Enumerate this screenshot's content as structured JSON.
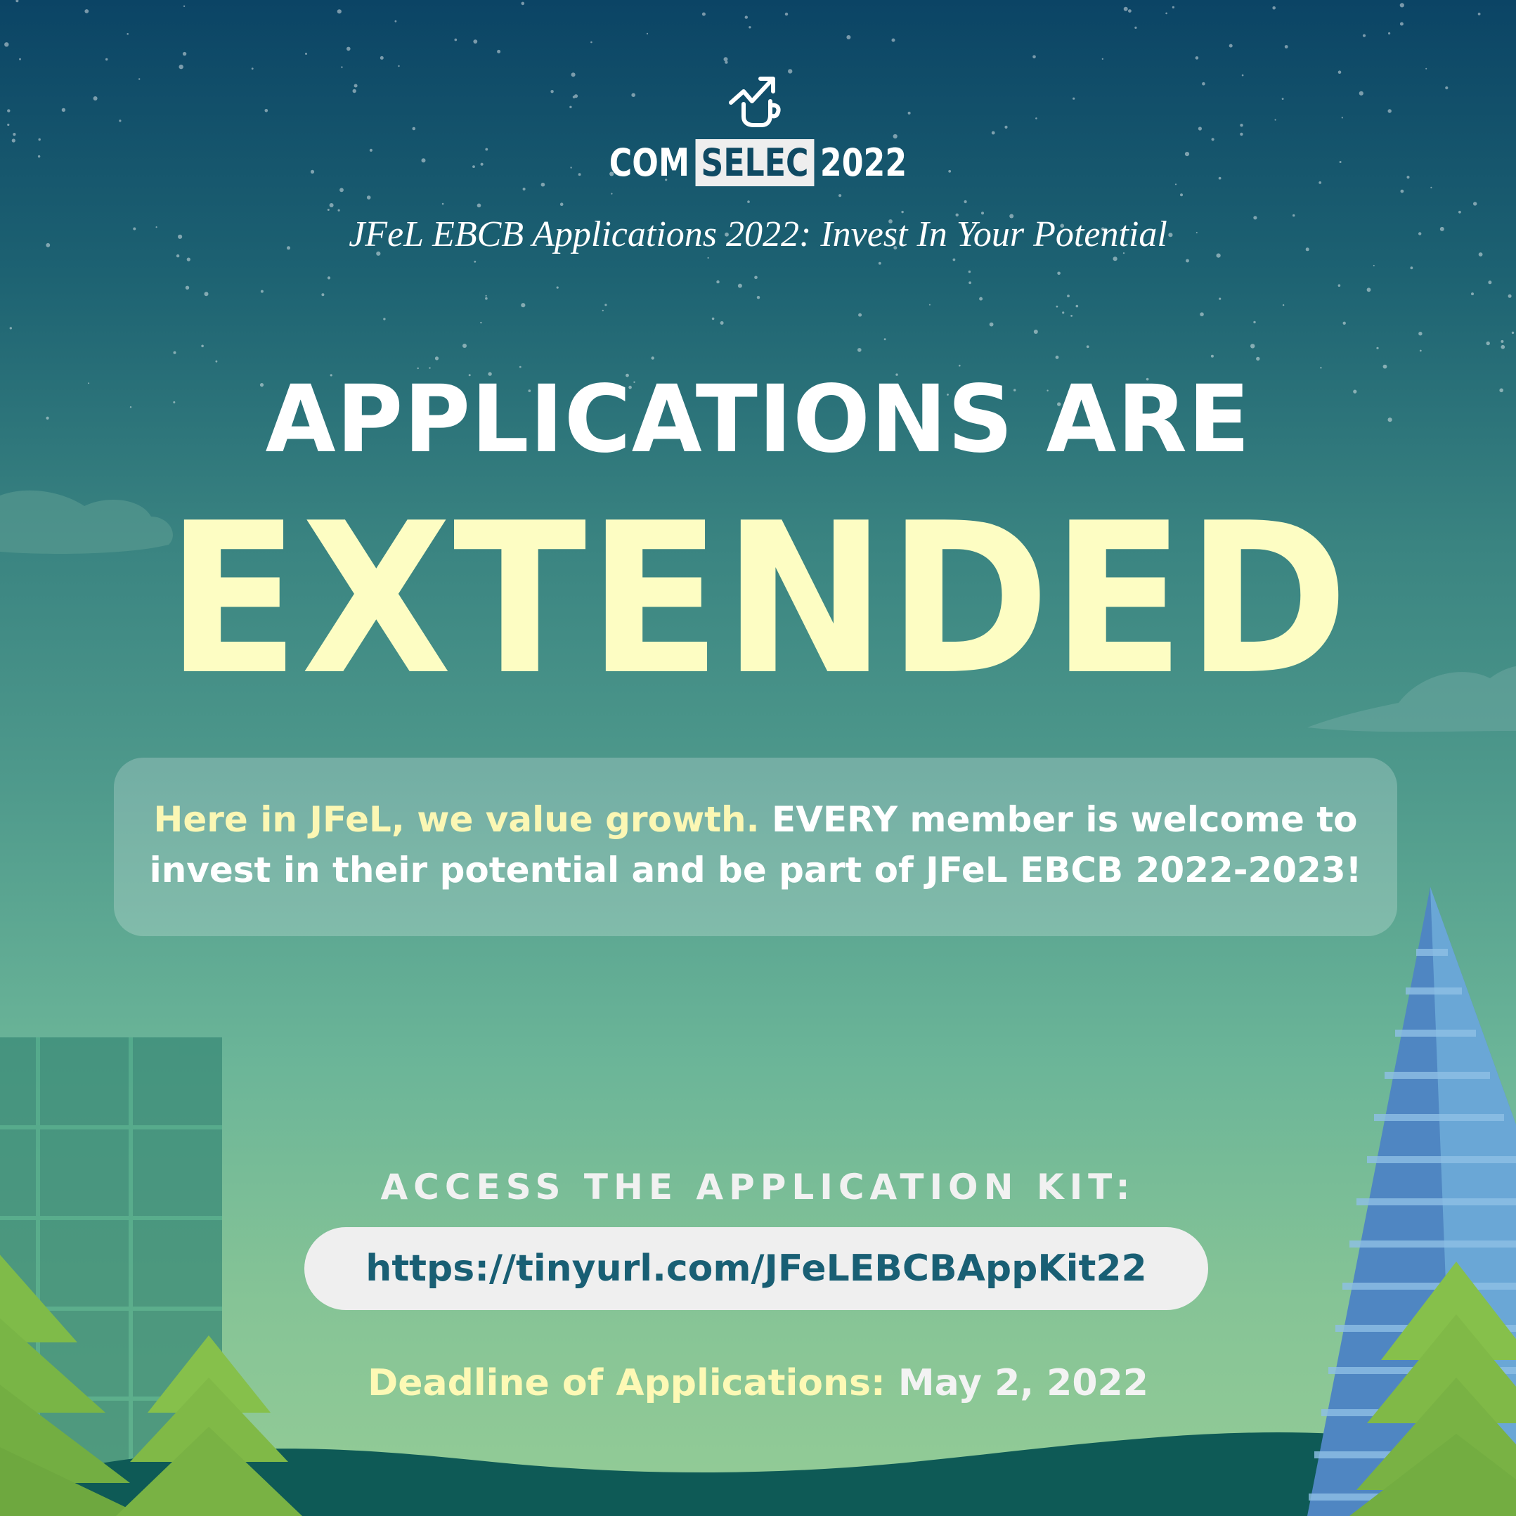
{
  "brand": {
    "prefix": "COM",
    "boxed": "SELEC",
    "year": "2022",
    "logo_icon": "mug-with-rising-arrow-icon"
  },
  "subtitle": "JFeL EBCB Applications 2022: Invest In Your Potential",
  "headline": {
    "line1": "APPLICATIONS ARE",
    "line2": "EXTENDED"
  },
  "message": {
    "highlight": "Here in JFeL, we value growth.",
    "body": " EVERY member is welcome to invest in their potential and be part of JFeL EBCB 2022-2023!"
  },
  "kit": {
    "heading": "ACCESS THE APPLICATION KIT:",
    "url": "https://tinyurl.com/JFeLEBCBAppKit22"
  },
  "deadline": {
    "label": "Deadline of Applications:",
    "date": " May 2, 2022"
  },
  "colors": {
    "headline_accent": "#fdfdc3",
    "highlight_text": "#fbf7b4",
    "link_text": "#195f74",
    "tree_green": "#82bc4c",
    "building_blue": "#5b9fd0"
  }
}
